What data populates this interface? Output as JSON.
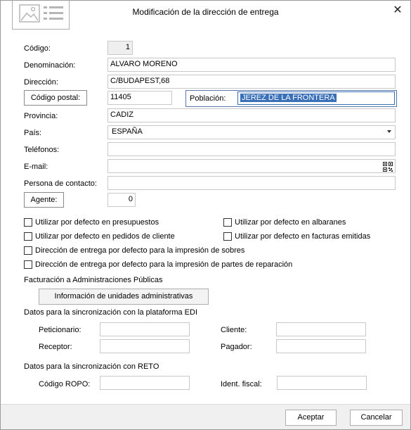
{
  "window": {
    "title": "Modificación de la dirección de entrega",
    "close_glyph": "✕"
  },
  "form": {
    "codigo": {
      "label": "Código:",
      "value": "1"
    },
    "denominacion": {
      "label": "Denominación:",
      "value": "ALVARO MORENO"
    },
    "direccion": {
      "label": "Dirección:",
      "value": "C/BUDAPEST,68"
    },
    "codigo_postal": {
      "button_label": "Código postal:",
      "value": "11405"
    },
    "poblacion": {
      "label": "Población:",
      "value": "JEREZ DE LA FRONTERA"
    },
    "provincia": {
      "label": "Provincia:",
      "value": "CADIZ"
    },
    "pais": {
      "label": "País:",
      "value": "ESPAÑA"
    },
    "telefonos": {
      "label": "Teléfonos:",
      "value": ""
    },
    "email": {
      "label": "E-mail:",
      "value": ""
    },
    "persona_contacto": {
      "label": "Persona de contacto:",
      "value": ""
    },
    "agente": {
      "button_label": "Agente:",
      "value": "0"
    }
  },
  "checkboxes": [
    {
      "label": "Utilizar por defecto en presupuestos",
      "checked": false
    },
    {
      "label": "Utilizar por defecto en albaranes",
      "checked": false
    },
    {
      "label": "Utilizar por defecto en pedidos de cliente",
      "checked": false
    },
    {
      "label": "Utilizar por defecto en facturas emitidas",
      "checked": false
    },
    {
      "label": "Dirección de entrega por defecto para la impresión de sobres",
      "checked": false
    },
    {
      "label": "Dirección de entrega por defecto para la impresión de partes de reparación",
      "checked": false
    }
  ],
  "facturacion": {
    "heading": "Facturación a Administraciones Públicas",
    "button_label": "Información de unidades administrativas"
  },
  "edi": {
    "heading": "Datos para la sincronización con la plataforma EDI",
    "peticionario": "Peticionario:",
    "cliente": "Cliente:",
    "receptor": "Receptor:",
    "pagador": "Pagador:"
  },
  "reto": {
    "heading": "Datos para la sincronización con RETO",
    "codigo_ropo": "Código ROPO:",
    "ident_fiscal": "Ident. fiscal:"
  },
  "footer": {
    "accept_label": "Aceptar",
    "cancel_label": "Cancelar"
  },
  "colors": {
    "selection": "#3a70b8",
    "focus_border": "#5a78a8"
  }
}
